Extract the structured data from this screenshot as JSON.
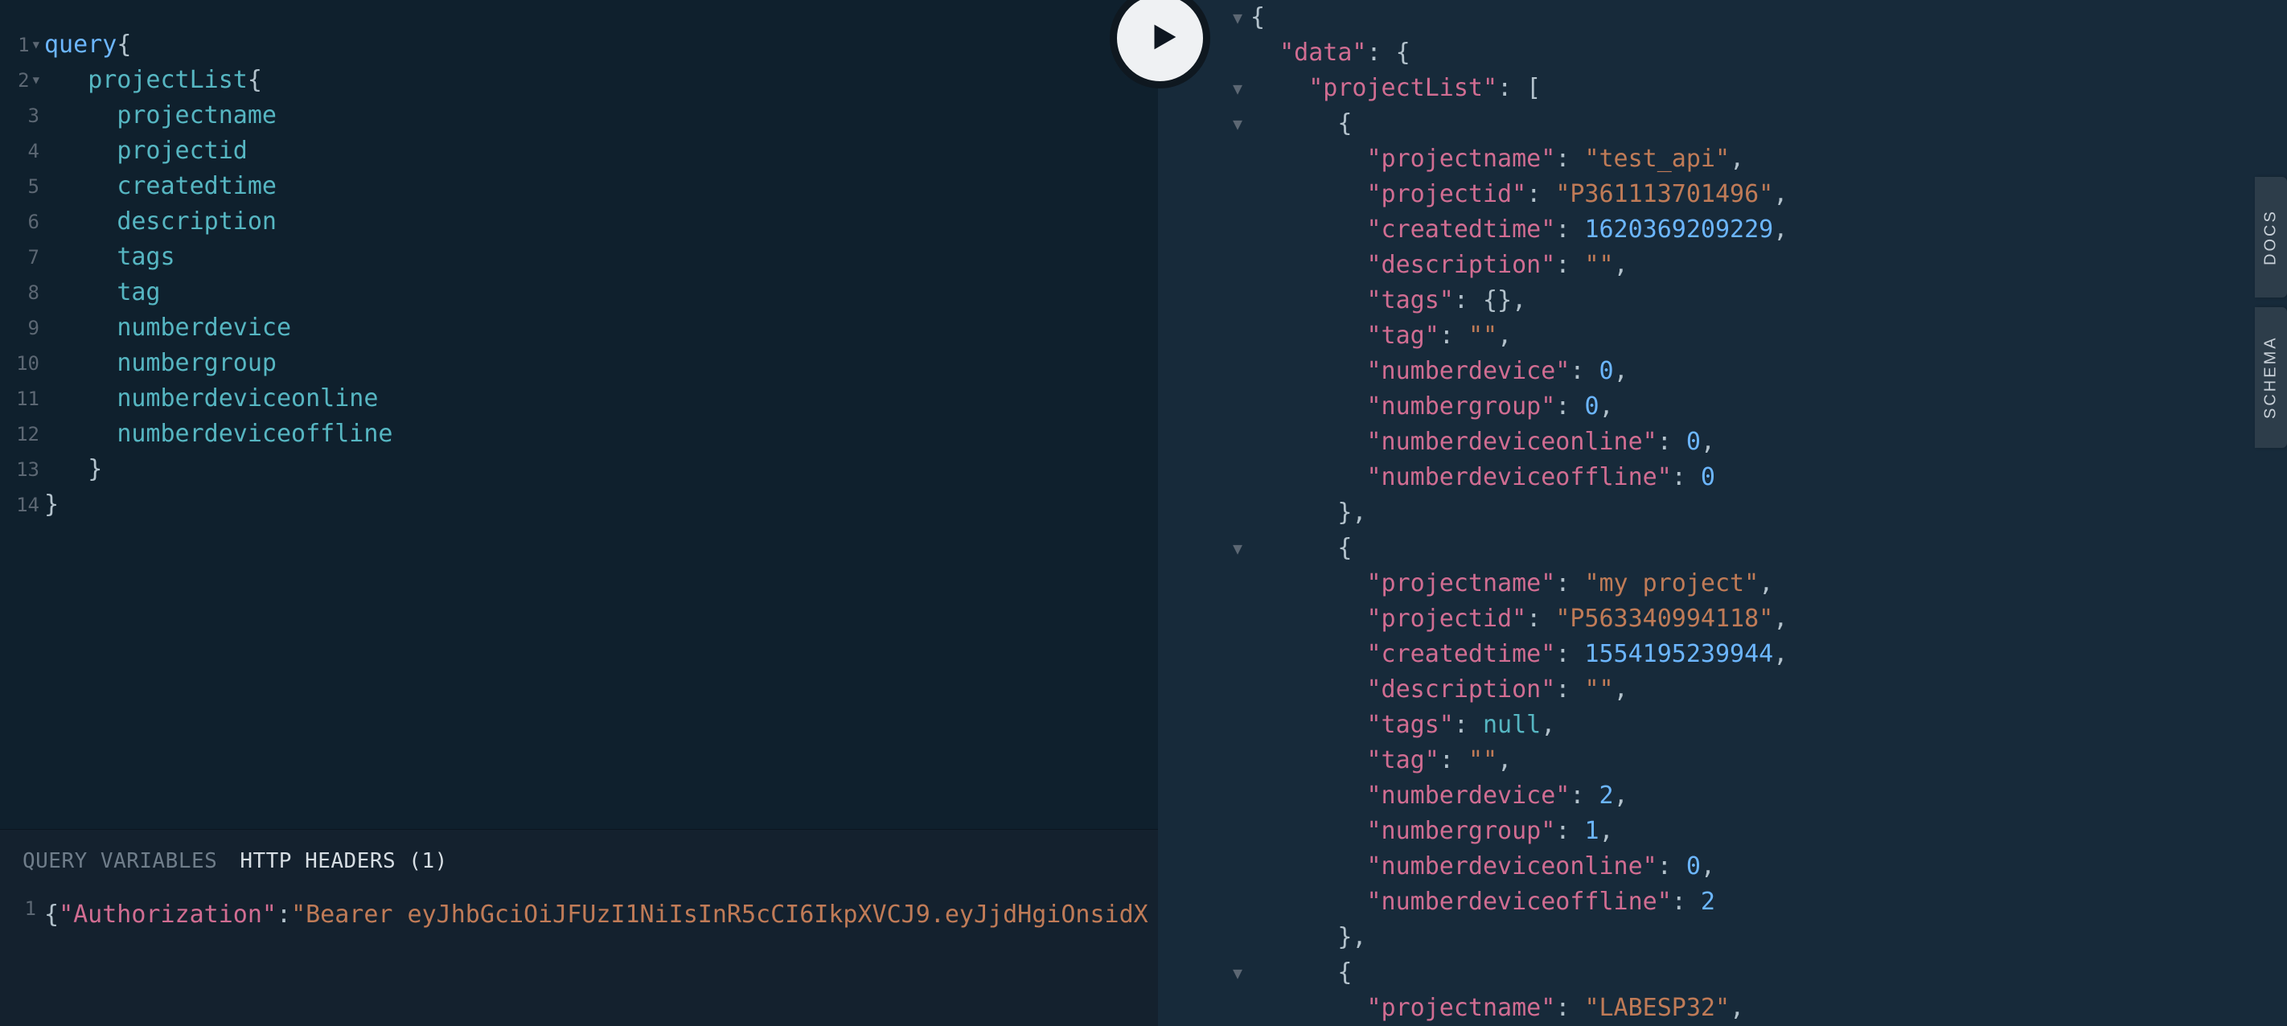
{
  "query_panel": {
    "lines": [
      {
        "n": "1",
        "fold": true,
        "tokens": [
          [
            "q-kw",
            "query"
          ],
          [
            "brace",
            "{"
          ]
        ]
      },
      {
        "n": "2",
        "fold": true,
        "tokens": [
          [
            "",
            "   "
          ],
          [
            "field",
            "projectList"
          ],
          [
            "brace",
            "{"
          ]
        ]
      },
      {
        "n": "3",
        "tokens": [
          [
            "",
            "     "
          ],
          [
            "field",
            "projectname"
          ]
        ]
      },
      {
        "n": "4",
        "tokens": [
          [
            "",
            "     "
          ],
          [
            "field",
            "projectid"
          ]
        ]
      },
      {
        "n": "5",
        "tokens": [
          [
            "",
            "     "
          ],
          [
            "field",
            "createdtime"
          ]
        ]
      },
      {
        "n": "6",
        "tokens": [
          [
            "",
            "     "
          ],
          [
            "field",
            "description"
          ]
        ]
      },
      {
        "n": "7",
        "tokens": [
          [
            "",
            "     "
          ],
          [
            "field",
            "tags"
          ]
        ]
      },
      {
        "n": "8",
        "tokens": [
          [
            "",
            "     "
          ],
          [
            "field",
            "tag"
          ]
        ]
      },
      {
        "n": "9",
        "tokens": [
          [
            "",
            "     "
          ],
          [
            "field",
            "numberdevice"
          ]
        ]
      },
      {
        "n": "10",
        "tokens": [
          [
            "",
            "     "
          ],
          [
            "field",
            "numbergroup"
          ]
        ]
      },
      {
        "n": "11",
        "tokens": [
          [
            "",
            "     "
          ],
          [
            "field",
            "numberdeviceonline"
          ]
        ]
      },
      {
        "n": "12",
        "tokens": [
          [
            "",
            "     "
          ],
          [
            "field",
            "numberdeviceoffline"
          ]
        ]
      },
      {
        "n": "13",
        "tokens": [
          [
            "",
            "   "
          ],
          [
            "brace",
            "}"
          ]
        ]
      },
      {
        "n": "14",
        "tokens": [
          [
            "brace",
            "}"
          ]
        ]
      }
    ]
  },
  "tabs": {
    "query_variables": "QUERY VARIABLES",
    "http_headers": "HTTP HEADERS (1)"
  },
  "headers_code": {
    "line_no": "1",
    "tokens": [
      [
        "brace",
        "{"
      ],
      [
        "jk",
        "\"Authorization\""
      ],
      [
        "brace",
        ":"
      ],
      [
        "js",
        "\"Bearer eyJhbGciOiJFUzI1NiIsInR5cCI6IkpXVCJ9.eyJjdHgiOnsidX"
      ]
    ]
  },
  "result_panel": {
    "lines": [
      {
        "fold": true,
        "tokens": [
          [
            "tok-p",
            "{"
          ]
        ]
      },
      {
        "tokens": [
          [
            "",
            "  "
          ],
          [
            "tok-key",
            "\"data\""
          ],
          [
            "tok-p",
            ": {"
          ]
        ]
      },
      {
        "fold": true,
        "tokens": [
          [
            "",
            "    "
          ],
          [
            "tok-key",
            "\"projectList\""
          ],
          [
            "tok-p",
            ": ["
          ]
        ]
      },
      {
        "fold": true,
        "tokens": [
          [
            "",
            "      "
          ],
          [
            "tok-p",
            "{"
          ]
        ]
      },
      {
        "tokens": [
          [
            "",
            "        "
          ],
          [
            "tok-key",
            "\"projectname\""
          ],
          [
            "tok-p",
            ": "
          ],
          [
            "tok-str",
            "\"test_api\""
          ],
          [
            "tok-p",
            ","
          ]
        ]
      },
      {
        "tokens": [
          [
            "",
            "        "
          ],
          [
            "tok-key",
            "\"projectid\""
          ],
          [
            "tok-p",
            ": "
          ],
          [
            "tok-str",
            "\"P361113701496\""
          ],
          [
            "tok-p",
            ","
          ]
        ]
      },
      {
        "tokens": [
          [
            "",
            "        "
          ],
          [
            "tok-key",
            "\"createdtime\""
          ],
          [
            "tok-p",
            ": "
          ],
          [
            "tok-num",
            "1620369209229"
          ],
          [
            "tok-p",
            ","
          ]
        ]
      },
      {
        "tokens": [
          [
            "",
            "        "
          ],
          [
            "tok-key",
            "\"description\""
          ],
          [
            "tok-p",
            ": "
          ],
          [
            "tok-str",
            "\"\""
          ],
          [
            "tok-p",
            ","
          ]
        ]
      },
      {
        "tokens": [
          [
            "",
            "        "
          ],
          [
            "tok-key",
            "\"tags\""
          ],
          [
            "tok-p",
            ": {},"
          ]
        ]
      },
      {
        "tokens": [
          [
            "",
            "        "
          ],
          [
            "tok-key",
            "\"tag\""
          ],
          [
            "tok-p",
            ": "
          ],
          [
            "tok-str",
            "\"\""
          ],
          [
            "tok-p",
            ","
          ]
        ]
      },
      {
        "tokens": [
          [
            "",
            "        "
          ],
          [
            "tok-key",
            "\"numberdevice\""
          ],
          [
            "tok-p",
            ": "
          ],
          [
            "tok-num",
            "0"
          ],
          [
            "tok-p",
            ","
          ]
        ]
      },
      {
        "tokens": [
          [
            "",
            "        "
          ],
          [
            "tok-key",
            "\"numbergroup\""
          ],
          [
            "tok-p",
            ": "
          ],
          [
            "tok-num",
            "0"
          ],
          [
            "tok-p",
            ","
          ]
        ]
      },
      {
        "tokens": [
          [
            "",
            "        "
          ],
          [
            "tok-key",
            "\"numberdeviceonline\""
          ],
          [
            "tok-p",
            ": "
          ],
          [
            "tok-num",
            "0"
          ],
          [
            "tok-p",
            ","
          ]
        ]
      },
      {
        "tokens": [
          [
            "",
            "        "
          ],
          [
            "tok-key",
            "\"numberdeviceoffline\""
          ],
          [
            "tok-p",
            ": "
          ],
          [
            "tok-num",
            "0"
          ]
        ]
      },
      {
        "tokens": [
          [
            "",
            "      "
          ],
          [
            "tok-p",
            "},"
          ]
        ]
      },
      {
        "fold": true,
        "tokens": [
          [
            "",
            "      "
          ],
          [
            "tok-p",
            "{"
          ]
        ]
      },
      {
        "tokens": [
          [
            "",
            "        "
          ],
          [
            "tok-key",
            "\"projectname\""
          ],
          [
            "tok-p",
            ": "
          ],
          [
            "tok-str",
            "\"my project\""
          ],
          [
            "tok-p",
            ","
          ]
        ]
      },
      {
        "tokens": [
          [
            "",
            "        "
          ],
          [
            "tok-key",
            "\"projectid\""
          ],
          [
            "tok-p",
            ": "
          ],
          [
            "tok-str",
            "\"P563340994118\""
          ],
          [
            "tok-p",
            ","
          ]
        ]
      },
      {
        "tokens": [
          [
            "",
            "        "
          ],
          [
            "tok-key",
            "\"createdtime\""
          ],
          [
            "tok-p",
            ": "
          ],
          [
            "tok-num",
            "1554195239944"
          ],
          [
            "tok-p",
            ","
          ]
        ]
      },
      {
        "tokens": [
          [
            "",
            "        "
          ],
          [
            "tok-key",
            "\"description\""
          ],
          [
            "tok-p",
            ": "
          ],
          [
            "tok-str",
            "\"\""
          ],
          [
            "tok-p",
            ","
          ]
        ]
      },
      {
        "tokens": [
          [
            "",
            "        "
          ],
          [
            "tok-key",
            "\"tags\""
          ],
          [
            "tok-p",
            ": "
          ],
          [
            "tok-null",
            "null"
          ],
          [
            "tok-p",
            ","
          ]
        ]
      },
      {
        "tokens": [
          [
            "",
            "        "
          ],
          [
            "tok-key",
            "\"tag\""
          ],
          [
            "tok-p",
            ": "
          ],
          [
            "tok-str",
            "\"\""
          ],
          [
            "tok-p",
            ","
          ]
        ]
      },
      {
        "tokens": [
          [
            "",
            "        "
          ],
          [
            "tok-key",
            "\"numberdevice\""
          ],
          [
            "tok-p",
            ": "
          ],
          [
            "tok-num",
            "2"
          ],
          [
            "tok-p",
            ","
          ]
        ]
      },
      {
        "tokens": [
          [
            "",
            "        "
          ],
          [
            "tok-key",
            "\"numbergroup\""
          ],
          [
            "tok-p",
            ": "
          ],
          [
            "tok-num",
            "1"
          ],
          [
            "tok-p",
            ","
          ]
        ]
      },
      {
        "tokens": [
          [
            "",
            "        "
          ],
          [
            "tok-key",
            "\"numberdeviceonline\""
          ],
          [
            "tok-p",
            ": "
          ],
          [
            "tok-num",
            "0"
          ],
          [
            "tok-p",
            ","
          ]
        ]
      },
      {
        "tokens": [
          [
            "",
            "        "
          ],
          [
            "tok-key",
            "\"numberdeviceoffline\""
          ],
          [
            "tok-p",
            ": "
          ],
          [
            "tok-num",
            "2"
          ]
        ]
      },
      {
        "tokens": [
          [
            "",
            "      "
          ],
          [
            "tok-p",
            "},"
          ]
        ]
      },
      {
        "fold": true,
        "tokens": [
          [
            "",
            "      "
          ],
          [
            "tok-p",
            "{"
          ]
        ]
      },
      {
        "tokens": [
          [
            "",
            "        "
          ],
          [
            "tok-key",
            "\"projectname\""
          ],
          [
            "tok-p",
            ": "
          ],
          [
            "tok-str",
            "\"LABESP32\""
          ],
          [
            "tok-p",
            ","
          ]
        ]
      }
    ]
  },
  "side": {
    "docs": "DOCS",
    "schema": "SCHEMA"
  }
}
